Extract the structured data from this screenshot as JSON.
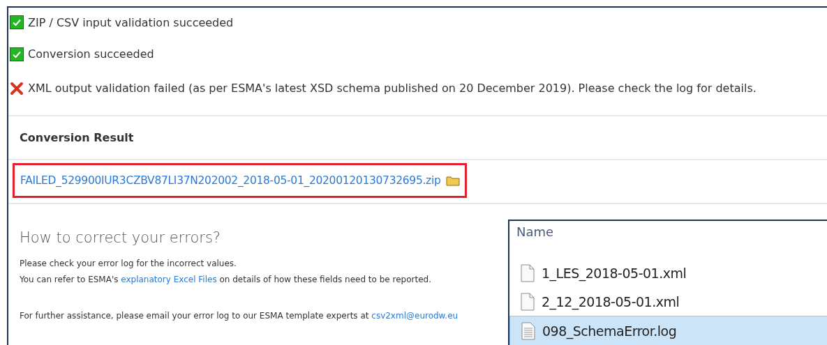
{
  "statuses": [
    {
      "kind": "ok",
      "text": "ZIP / CSV input validation succeeded"
    },
    {
      "kind": "ok",
      "text": "Conversion succeeded"
    },
    {
      "kind": "error",
      "text": "XML output validation failed (as per ESMA's latest XSD schema published on 20 December 2019). Please check the log for details."
    }
  ],
  "result": {
    "heading": "Conversion Result",
    "file_link": "FAILED_529900IUR3CZBV87LI37N202002_2018-05-01_20200120130732695.zip"
  },
  "help": {
    "heading": "How to correct your errors?",
    "line_1": "Please check your error log for the incorrect values.",
    "line_2_before": "You can refer to ESMA's",
    "line_2_link": "explanatory Excel Files",
    "line_2_after": "on details of how these fields need to be reported.",
    "line_3": "For further assistance, please email your error log to our ESMA template experts at",
    "email": "csv2xml@eurodw.eu"
  },
  "explorer": {
    "column": "Name",
    "files": [
      {
        "kind": "blank",
        "name": "1_LES_2018-05-01.xml",
        "selected": false
      },
      {
        "kind": "blank",
        "name": "2_12_2018-05-01.xml",
        "selected": false
      },
      {
        "kind": "text",
        "name": "098_SchemaError.log",
        "selected": true
      }
    ]
  }
}
